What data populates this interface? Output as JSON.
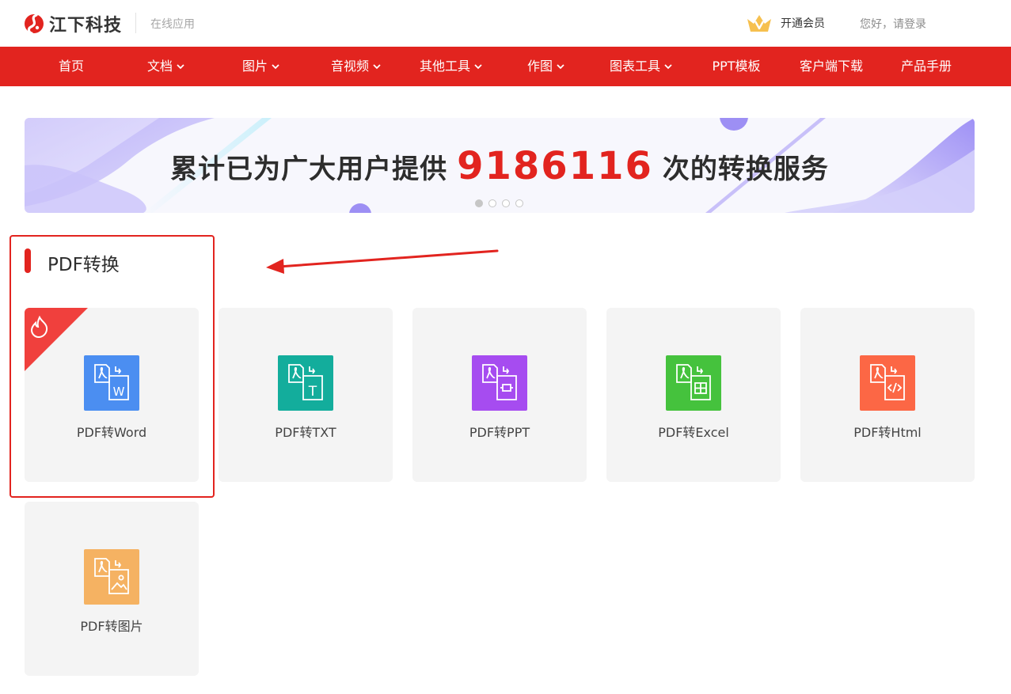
{
  "header": {
    "logo_text": "江下科技",
    "logo_sub": "在线应用",
    "vip_label": "开通会员",
    "login_label": "您好，请登录"
  },
  "nav": {
    "items": [
      {
        "label": "首页",
        "dropdown": false
      },
      {
        "label": "文档",
        "dropdown": true
      },
      {
        "label": "图片",
        "dropdown": true
      },
      {
        "label": "音视频",
        "dropdown": true
      },
      {
        "label": "其他工具",
        "dropdown": true
      },
      {
        "label": "作图",
        "dropdown": true
      },
      {
        "label": "图表工具",
        "dropdown": true
      },
      {
        "label": "PPT模板",
        "dropdown": false
      },
      {
        "label": "客户端下载",
        "dropdown": false
      },
      {
        "label": "产品手册",
        "dropdown": false
      }
    ]
  },
  "banner": {
    "text_before": "累计已为广大用户提供",
    "count": "9186116",
    "text_after": "次的转换服务",
    "slides": 4,
    "active_slide": 1
  },
  "section": {
    "title": "PDF转换"
  },
  "tools": [
    {
      "label": "PDF转Word",
      "icon": "pdf-to-word-icon",
      "color": "#4b8ef1",
      "hot": true
    },
    {
      "label": "PDF转TXT",
      "icon": "pdf-to-txt-icon",
      "color": "#13ad9c",
      "hot": false
    },
    {
      "label": "PDF转PPT",
      "icon": "pdf-to-ppt-icon",
      "color": "#a64cf0",
      "hot": false
    },
    {
      "label": "PDF转Excel",
      "icon": "pdf-to-excel-icon",
      "color": "#45c23d",
      "hot": false
    },
    {
      "label": "PDF转Html",
      "icon": "pdf-to-html-icon",
      "color": "#fc6745",
      "hot": false
    },
    {
      "label": "PDF转图片",
      "icon": "pdf-to-image-icon",
      "color": "#f5b262",
      "hot": false
    }
  ],
  "colors": {
    "brand_red": "#e2241f",
    "card_bg": "#f4f4f4"
  }
}
